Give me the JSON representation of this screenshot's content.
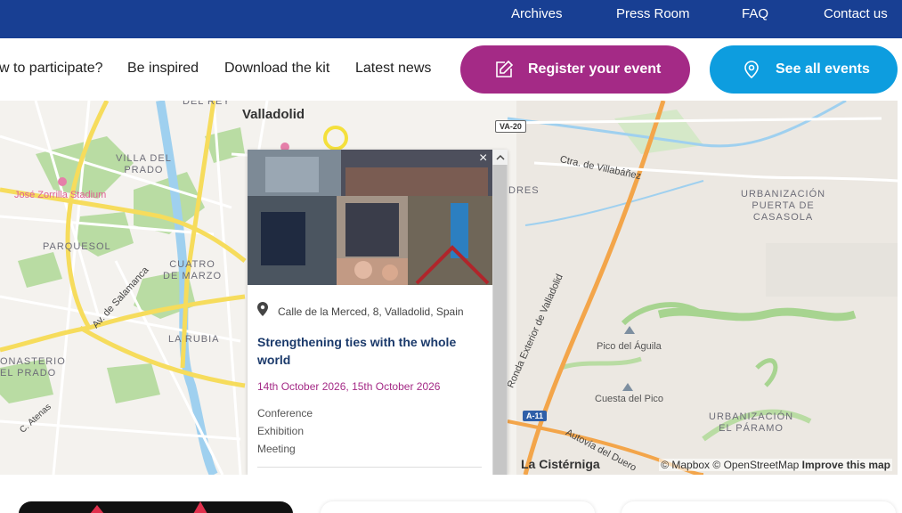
{
  "topbar": {
    "links": [
      "Archives",
      "Press Room",
      "FAQ",
      "Contact us"
    ]
  },
  "nav": {
    "links": [
      "w to participate?",
      "Be inspired",
      "Download the kit",
      "Latest news"
    ],
    "register_button": "Register your event",
    "events_button": "See all events"
  },
  "map": {
    "city_main": "Valladolid",
    "city_secondary": "La Cistérniga",
    "areas": {
      "del_rey": "DEL REY",
      "villa_del_prado": "VILLA DEL\nPRADO",
      "parquesol": "PARQUESOL",
      "cuatro_de_marzo": "CUATRO\nDE MARZO",
      "la_rubia": "LA RUBIA",
      "monasterio": "ONASTERIO\nEL PRADO",
      "pores": "DRES",
      "puerta": "URBANIZACIÓN\nPUERTA DE\nCASASOLA",
      "el_paramo": "URBANIZACIÓN\nEL PÁRAMO"
    },
    "stadium": "José Zorrilla Stadium",
    "peaks": [
      "Pico del Águila",
      "Cuesta del Pico"
    ],
    "roads": {
      "villabanez": "Ctra. de Villabáñez",
      "ronda": "Ronda Exterior de Valladolid",
      "autovia": "Autovía del Duero",
      "salamanca": "Av. de Salamanca",
      "atenas": "C. Atenas"
    },
    "shields": [
      "VA-20",
      "A-11"
    ],
    "colors": {
      "land": "#ece8e2",
      "green": "#b9dca3",
      "water": "#9fd0ef",
      "highway": "#f3a54a",
      "yellow_road": "#f6dc5c"
    },
    "attribution": {
      "mapbox": "© Mapbox",
      "osm": "© OpenStreetMap",
      "improve": "Improve this map"
    }
  },
  "popup": {
    "close": "×",
    "address": "Calle de la Merced, 8, Valladolid, Spain",
    "title": "Strengthening ties with the whole world",
    "dates": "14th October 2026, 15th October 2026",
    "types": [
      "Conference",
      "Exhibition",
      "Meeting"
    ]
  },
  "colors": {
    "topbar": "#183f93",
    "register": "#a42a86",
    "events": "#0d9ddf",
    "title": "#1b3a6b"
  }
}
